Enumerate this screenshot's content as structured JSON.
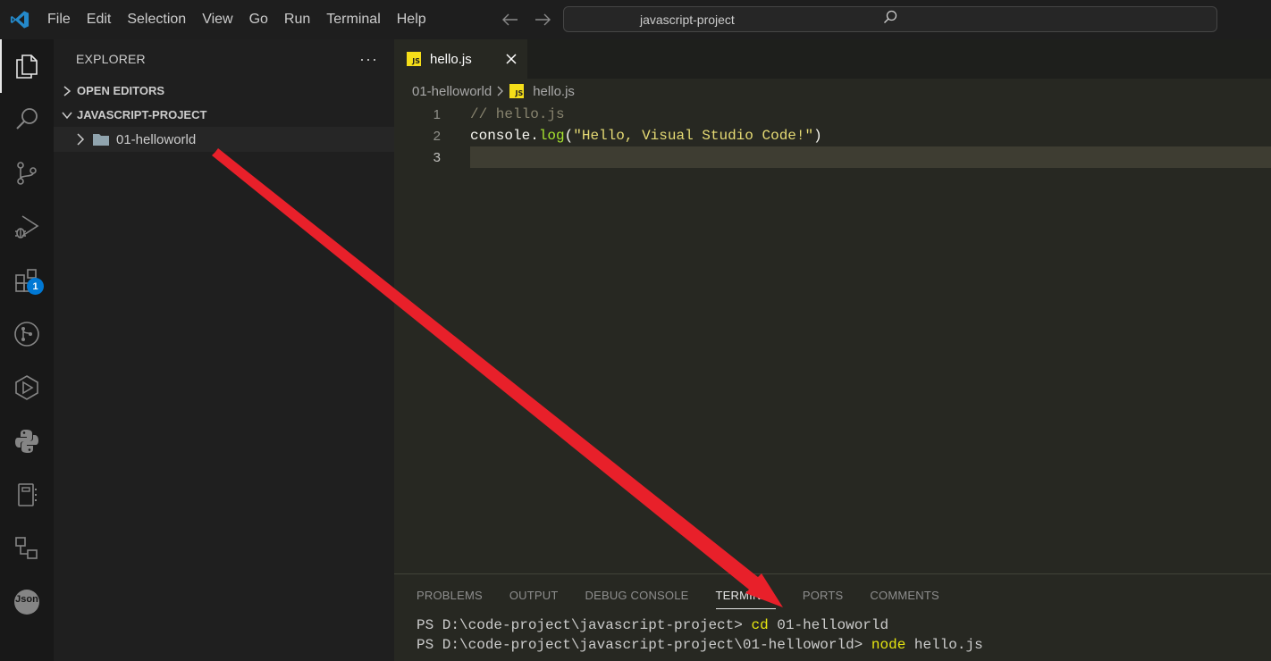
{
  "menu": {
    "items": [
      "File",
      "Edit",
      "Selection",
      "View",
      "Go",
      "Run",
      "Terminal",
      "Help"
    ]
  },
  "search": {
    "text": "javascript-project"
  },
  "activity_bar": {
    "icons": [
      "explorer-icon",
      "search-icon",
      "source-control-icon",
      "run-debug-icon",
      "extensions-icon",
      "git-graph-icon",
      "remote-icon",
      "python-icon",
      "notebook-icon",
      "workflow-icon",
      "json-icon"
    ],
    "extensions_badge": "1",
    "json_label": "Json"
  },
  "sidebar": {
    "title": "EXPLORER",
    "more": "···",
    "sections": {
      "open_editors": "OPEN EDITORS",
      "project": "JAVASCRIPT-PROJECT"
    },
    "tree": [
      {
        "label": "01-helloworld",
        "type": "folder"
      }
    ]
  },
  "editor": {
    "tab": {
      "label": "hello.js",
      "icon": "JS"
    },
    "breadcrumb": {
      "folder": "01-helloworld",
      "file": "hello.js"
    },
    "lines": [
      {
        "number": "1",
        "comment": "// hello.js"
      },
      {
        "number": "2",
        "obj": "console",
        "dot": ".",
        "func": "log",
        "open": "(",
        "str": "\"Hello, Visual Studio Code!\"",
        "close": ")"
      },
      {
        "number": "3"
      }
    ]
  },
  "panel": {
    "tabs": [
      "PROBLEMS",
      "OUTPUT",
      "DEBUG CONSOLE",
      "TERMINAL",
      "PORTS",
      "COMMENTS"
    ],
    "active_tab": "TERMINAL",
    "terminal": [
      {
        "prompt": "PS D:\\code-project\\javascript-project> ",
        "cmd": "cd",
        "args": " 01-helloworld"
      },
      {
        "prompt": "PS D:\\code-project\\javascript-project\\01-helloworld> ",
        "cmd": "node",
        "args": " hello.js"
      }
    ]
  },
  "colors": {
    "accent": "#0078d4",
    "annotation_arrow": "#e8202a",
    "js_icon": "#f5de19"
  }
}
